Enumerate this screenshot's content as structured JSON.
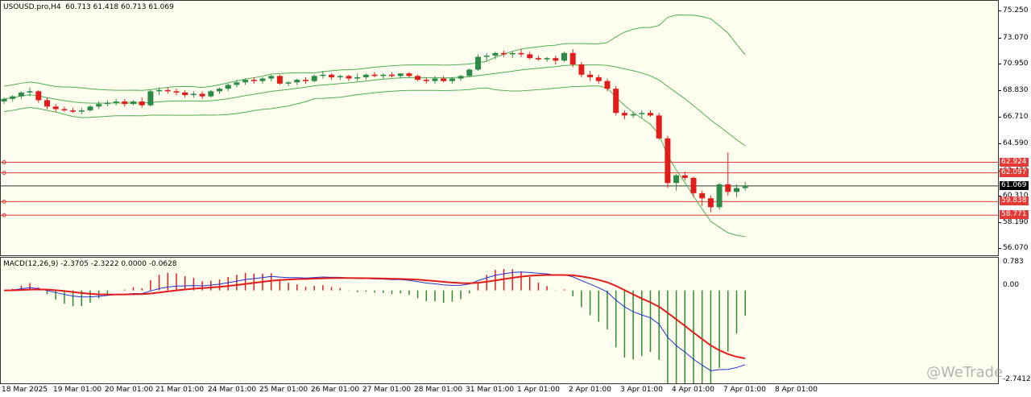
{
  "chart_header": {
    "symbol_tf": "USOUSD.pro,H4",
    "ohlc": "60.713 61.418 60.713 61.069"
  },
  "macd_header": {
    "label": "MACD(12,26,9)",
    "values": "-2.3705 -2.3222 0.0000 -0.0628"
  },
  "colors": {
    "bull": "#2e8b46",
    "bear": "#e21b1b",
    "bands": "#4caf50",
    "hlines": "#e53935",
    "current_line": "#333333",
    "macd_line": "#1f2fd6",
    "signal_line": "#e21b1b",
    "hist_up": "#e21b1b",
    "hist_down": "#2e8b2e",
    "pane_bg": "#fffff0"
  },
  "price_axis": [
    "75.250",
    "73.070",
    "70.950",
    "68.830",
    "66.710",
    "64.590",
    "62.470",
    "60.310",
    "58.190",
    "56.070"
  ],
  "macd_axis": [
    "0.783",
    "0.00",
    "-2.7412"
  ],
  "price_tags": [
    {
      "label": "62.924",
      "price": 62.924,
      "kind": "level"
    },
    {
      "label": "62.097",
      "price": 62.097,
      "kind": "level"
    },
    {
      "label": "61.069",
      "price": 61.069,
      "kind": "current"
    },
    {
      "label": "59.838",
      "price": 59.838,
      "kind": "level"
    },
    {
      "label": "58.771",
      "price": 58.771,
      "kind": "level"
    }
  ],
  "time_axis": [
    "18 Mar 2025",
    "19 Mar 01:00",
    "20 Mar 01:00",
    "21 Mar 01:00",
    "24 Mar 01:00",
    "25 Mar 01:00",
    "26 Mar 01:00",
    "27 Mar 01:00",
    "28 Mar 01:00",
    "31 Mar 01:00",
    "1 Apr 01:00",
    "2 Apr 01:00",
    "3 Apr 01:00",
    "4 Apr 01:00",
    "7 Apr 01:00",
    "8 Apr 01:00"
  ],
  "watermark": "@WeTrade",
  "chart_data": {
    "type": "candlestick",
    "title": "USOUSD.pro,H4",
    "y_range": [
      55.5,
      75.6
    ],
    "candles_ohlc": [
      [
        67.7,
        68.0,
        67.5,
        67.9
      ],
      [
        67.9,
        68.2,
        67.7,
        68.1
      ],
      [
        68.1,
        68.5,
        67.9,
        68.4
      ],
      [
        68.4,
        68.8,
        68.1,
        68.5
      ],
      [
        68.5,
        68.6,
        67.6,
        67.8
      ],
      [
        67.8,
        68.0,
        67.1,
        67.3
      ],
      [
        67.3,
        67.5,
        66.9,
        67.1
      ],
      [
        67.1,
        67.3,
        66.9,
        67.0
      ],
      [
        67.0,
        67.2,
        66.8,
        66.9
      ],
      [
        66.9,
        67.2,
        66.7,
        67.0
      ],
      [
        67.0,
        67.4,
        66.9,
        67.3
      ],
      [
        67.3,
        67.7,
        67.1,
        67.5
      ],
      [
        67.5,
        67.8,
        67.3,
        67.6
      ],
      [
        67.6,
        67.9,
        67.4,
        67.7
      ],
      [
        67.7,
        67.9,
        67.3,
        67.5
      ],
      [
        67.5,
        67.8,
        67.4,
        67.7
      ],
      [
        67.7,
        68.0,
        67.2,
        67.4
      ],
      [
        67.4,
        68.6,
        67.3,
        68.5
      ],
      [
        68.5,
        68.8,
        68.2,
        68.6
      ],
      [
        68.6,
        68.8,
        68.3,
        68.5
      ],
      [
        68.5,
        68.7,
        68.2,
        68.4
      ],
      [
        68.4,
        68.6,
        68.0,
        68.2
      ],
      [
        68.2,
        68.5,
        68.0,
        68.3
      ],
      [
        68.3,
        68.5,
        67.9,
        68.1
      ],
      [
        68.1,
        68.6,
        68.0,
        68.5
      ],
      [
        68.5,
        68.8,
        68.3,
        68.7
      ],
      [
        68.7,
        69.1,
        68.5,
        69.0
      ],
      [
        69.0,
        69.4,
        68.8,
        69.2
      ],
      [
        69.2,
        69.5,
        69.0,
        69.4
      ],
      [
        69.4,
        69.6,
        69.1,
        69.3
      ],
      [
        69.3,
        69.6,
        69.1,
        69.5
      ],
      [
        69.5,
        69.8,
        69.3,
        69.7
      ],
      [
        69.7,
        69.8,
        69.0,
        69.1
      ],
      [
        69.1,
        69.3,
        68.9,
        69.2
      ],
      [
        69.2,
        69.5,
        69.0,
        69.4
      ],
      [
        69.4,
        69.6,
        69.1,
        69.3
      ],
      [
        69.3,
        69.8,
        69.2,
        69.7
      ],
      [
        69.7,
        70.1,
        69.5,
        69.8
      ],
      [
        69.8,
        69.9,
        69.4,
        69.6
      ],
      [
        69.6,
        69.8,
        69.4,
        69.7
      ],
      [
        69.7,
        69.8,
        69.3,
        69.5
      ],
      [
        69.5,
        69.9,
        69.3,
        69.6
      ],
      [
        69.6,
        69.9,
        69.4,
        69.8
      ],
      [
        69.8,
        70.0,
        69.6,
        69.7
      ],
      [
        69.7,
        69.9,
        69.5,
        69.8
      ],
      [
        69.8,
        70.0,
        69.6,
        69.7
      ],
      [
        69.7,
        69.9,
        69.5,
        69.9
      ],
      [
        69.9,
        70.0,
        69.6,
        69.7
      ],
      [
        69.7,
        69.8,
        69.3,
        69.4
      ],
      [
        69.4,
        69.6,
        69.1,
        69.3
      ],
      [
        69.3,
        69.7,
        69.1,
        69.5
      ],
      [
        69.5,
        69.7,
        69.2,
        69.3
      ],
      [
        69.3,
        69.6,
        69.1,
        69.5
      ],
      [
        69.5,
        69.8,
        69.3,
        69.7
      ],
      [
        69.7,
        70.3,
        69.6,
        70.2
      ],
      [
        70.2,
        71.4,
        70.1,
        71.2
      ],
      [
        71.2,
        71.5,
        70.9,
        71.3
      ],
      [
        71.3,
        71.6,
        71.0,
        71.5
      ],
      [
        71.5,
        71.7,
        71.2,
        71.4
      ],
      [
        71.4,
        71.6,
        71.1,
        71.5
      ],
      [
        71.5,
        71.8,
        71.2,
        71.4
      ],
      [
        71.4,
        71.6,
        71.0,
        71.1
      ],
      [
        71.1,
        71.3,
        70.9,
        71.0
      ],
      [
        71.0,
        71.2,
        70.8,
        71.1
      ],
      [
        71.1,
        71.3,
        70.6,
        70.9
      ],
      [
        70.9,
        71.6,
        70.8,
        71.5
      ],
      [
        71.5,
        71.8,
        70.4,
        70.6
      ],
      [
        70.6,
        70.8,
        69.6,
        69.8
      ],
      [
        69.8,
        70.1,
        69.3,
        69.6
      ],
      [
        69.6,
        69.8,
        69.1,
        69.3
      ],
      [
        69.3,
        69.5,
        68.5,
        68.7
      ],
      [
        68.7,
        68.9,
        66.6,
        66.8
      ],
      [
        66.8,
        67.0,
        66.3,
        66.6
      ],
      [
        66.6,
        66.9,
        66.4,
        66.7
      ],
      [
        66.7,
        67.0,
        66.4,
        66.8
      ],
      [
        66.8,
        67.0,
        66.5,
        66.6
      ],
      [
        66.6,
        66.8,
        64.7,
        64.8
      ],
      [
        64.8,
        65.0,
        60.9,
        61.3
      ],
      [
        61.3,
        62.0,
        60.7,
        61.9
      ],
      [
        61.9,
        62.2,
        61.5,
        61.7
      ],
      [
        61.7,
        61.8,
        60.2,
        60.5
      ],
      [
        60.5,
        60.7,
        59.5,
        60.1
      ],
      [
        60.1,
        60.3,
        59.0,
        59.4
      ],
      [
        59.4,
        61.3,
        59.2,
        61.2
      ],
      [
        61.2,
        63.7,
        60.3,
        60.6
      ],
      [
        60.6,
        61.2,
        60.2,
        60.9
      ],
      [
        60.9,
        61.4,
        60.7,
        61.1
      ]
    ],
    "series_note": "Bollinger Bands (upper, middle, lower) and MACD(12,26,9) histogram, MACD and signal lines in sub-window"
  }
}
